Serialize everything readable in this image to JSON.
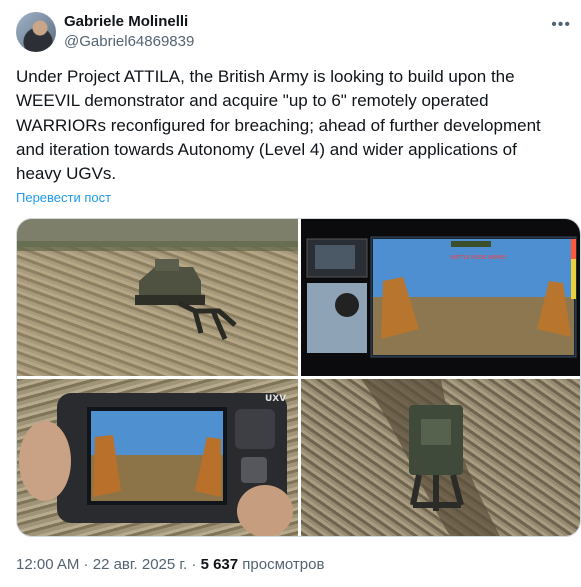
{
  "author": {
    "name": "Gabriele Molinelli",
    "handle": "@Gabriel64869839"
  },
  "post": {
    "text": "Under Project ATTILA, the British Army is looking to build upon the WEEVIL demonstrator and acquire \"up to 6\" remotely operated WARRIORs reconfigured for breaching; ahead of further development and iteration towards Autonomy (Level 4) and wider applications of heavy UGVs.",
    "translate_label": "Перевести пост",
    "time": "12:00 AM",
    "date": "22 авг. 2025 г.",
    "views_count": "5 637",
    "views_label": "просмотров"
  },
  "media": {
    "photo2_hud_text": "BATTLE MODE ARMED",
    "photo3_brand": "UXV"
  },
  "colors": {
    "link": "#1d9bf0",
    "secondary_text": "#536471",
    "primary_text": "#0f1419"
  }
}
